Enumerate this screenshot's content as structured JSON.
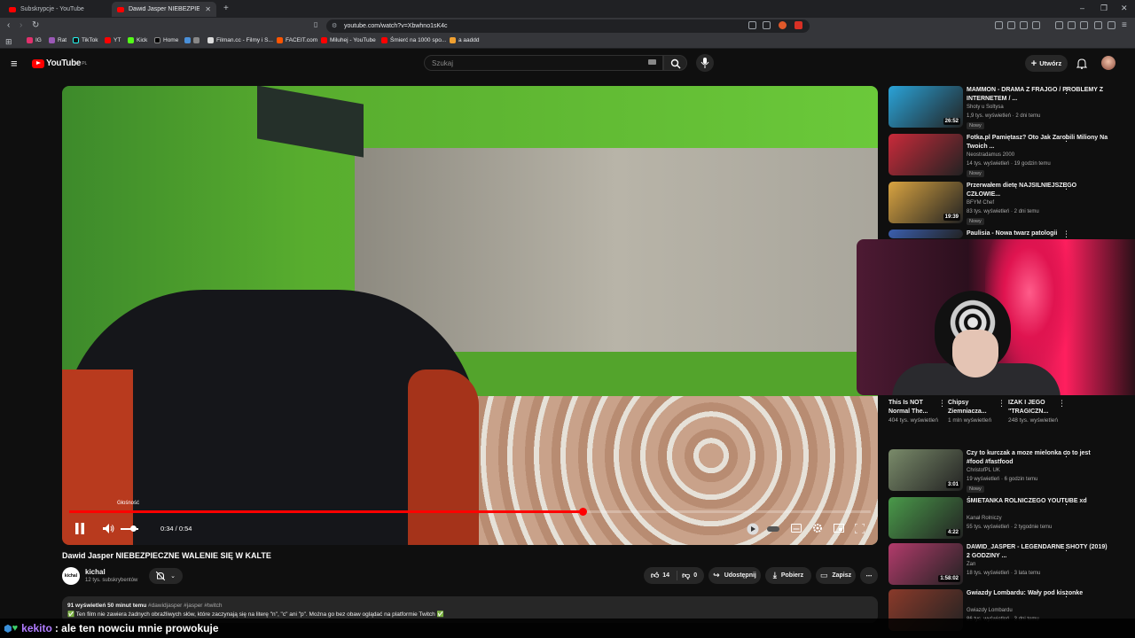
{
  "browser": {
    "tabs": [
      {
        "title": "Subskrypcje - YouTube",
        "active": false
      },
      {
        "title": "Dawid Jasper NIEBEZPIECZN",
        "active": true
      }
    ],
    "url": "youtube.com/watch?v=Xbwhno1sK4c",
    "bookmarks": [
      "IG",
      "Rat",
      "TikTok",
      "YT",
      "Kick",
      "Home",
      "Filman.cc - Filmy i S...",
      "FACEIT.com",
      "Miluhej - YouTube",
      "Śmierć na 1000 spo...",
      "a aaddd"
    ]
  },
  "youtube": {
    "logo": "YouTube",
    "region": "PL",
    "search_placeholder": "Szukaj",
    "create_label": "Utwórz"
  },
  "player": {
    "progress": 0.64,
    "volume_tooltip": "Głośność",
    "time": "0:34 / 0:54"
  },
  "video": {
    "title": "Dawid Jasper NIEBEZPIECZNE WALENIE SIĘ W KALTE",
    "channel": "kichal",
    "channel_avatar_text": "kichal",
    "subscribers": "12 tys. subskrybentów",
    "likes": "14",
    "dislikes": "0",
    "share_label": "Udostępnij",
    "download_label": "Pobierz",
    "save_label": "Zapisz",
    "views_time": "91 wyświetleń  50 minut temu",
    "tags": "#dawidjasper #jasper #twitch",
    "description": "✅ Ten film nie zawiera żadnych obraźliwych słów, które zaczynają się na literę \"n\", \"c\" ani \"p\". Można go bez obaw oglądać na platformie Twitch ✅"
  },
  "recommendations": [
    {
      "title": "MAMMON - DRAMA Z FRAJGO / PROBLEMY Z INTERNETEM / ...",
      "channel": "Shoty u Soltysa",
      "stats": "1,9 tys. wyświetleń · 2 dni temu",
      "badge": "Nowy",
      "duration": "26:52",
      "color": "#2aa3d8"
    },
    {
      "title": "Fotka.pl Pamiętasz? Oto Jak Zarobili Miliony Na Twoich ...",
      "channel": "Neostradamus 2000",
      "stats": "14 tys. wyświetleń · 19 godzin temu",
      "badge": "Nowy",
      "duration": "",
      "color": "#c92a3a"
    },
    {
      "title": "Przerwałem dietę NAJSILNIEJSZEGO CZŁOWIE...",
      "channel": "BFYM Chef",
      "stats": "83 tys. wyświetleń · 2 dni temu",
      "badge": "Nowy",
      "duration": "19:39",
      "color": "#d9a441"
    },
    {
      "title": "Paulisia - Nowa twarz patologii",
      "channel": "",
      "stats": "",
      "badge": "",
      "duration": "",
      "color": "#3b5fb0"
    }
  ],
  "shorts": [
    {
      "title": "This Is NOT Normal The...",
      "views": "404 tys. wyświetleń"
    },
    {
      "title": "Chipsy Ziemniacza...",
      "views": "1 mln wyświetleń"
    },
    {
      "title": "IZAK I JEGO \"TRAGICZN...",
      "views": "248 tys. wyświetleń"
    }
  ],
  "recommendations2": [
    {
      "title": "Czy to kurczak a moze mielonka co to jest #food #fastfood",
      "channel": "ChristofPL UK",
      "stats": "19 wyświetleń · 6 godzin temu",
      "badge": "Nowy",
      "duration": "3:01",
      "color": "#7a8b6a"
    },
    {
      "title": "ŚMIETANKA ROLNICZEGO YOUTUBE xd",
      "channel": "Kanał Rolniczy",
      "stats": "55 tys. wyświetleń · 2 tygodnie temu",
      "badge": "",
      "duration": "4:22",
      "color": "#4a9a4a"
    },
    {
      "title": "DAWID_JASPER - LEGENDARNE SHOTY (2019) 2 GODZINY ...",
      "channel": "Zan",
      "stats": "18 tys. wyświetleń · 3 lata temu",
      "badge": "",
      "duration": "1:58:02",
      "color": "#b23b6b"
    },
    {
      "title": "Gwiazdy Lombardu: Wały pod kiszonke",
      "channel": "Gwiazdy Lombardu",
      "stats": "86 tys. wyświetleń · 3 dni temu",
      "badge": "",
      "duration": "",
      "color": "#8a3a2a"
    }
  ],
  "chat": {
    "user": "kekito",
    "message": ": ale ten nowciu mnie prowokuje"
  },
  "colors": {
    "accent": "#ff0000",
    "background": "#0f0f0f"
  }
}
